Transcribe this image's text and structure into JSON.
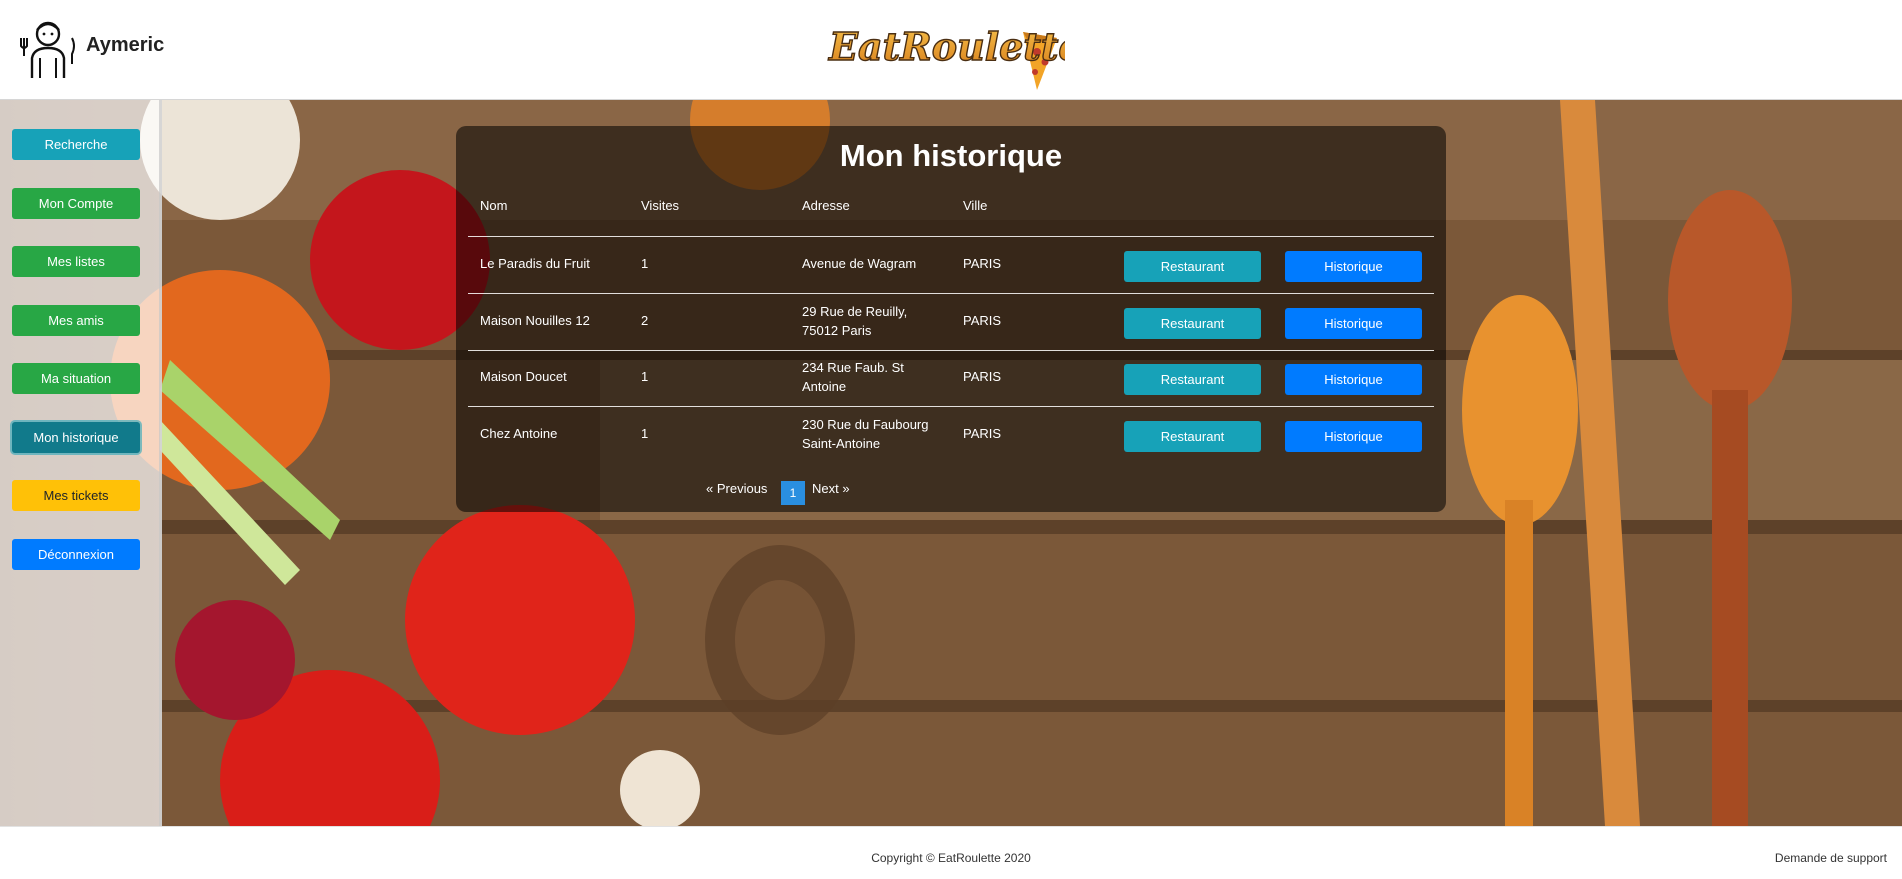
{
  "header": {
    "username": "Aymeric",
    "logo_text": "EatRoulette"
  },
  "sidebar": {
    "items": [
      {
        "label": "Recherche"
      },
      {
        "label": "Mon Compte"
      },
      {
        "label": "Mes listes"
      },
      {
        "label": "Mes amis"
      },
      {
        "label": "Ma situation"
      },
      {
        "label": "Mon historique"
      },
      {
        "label": "Mes tickets"
      },
      {
        "label": "Déconnexion"
      }
    ]
  },
  "history": {
    "title": "Mon historique",
    "columns": [
      "Nom",
      "Visites",
      "Adresse",
      "Ville"
    ],
    "rows": [
      {
        "name": "Le Paradis du Fruit",
        "visits": "1",
        "address_line1": "Avenue de Wagram",
        "address_line2": "",
        "city": "PARIS",
        "restaurant_label": "Restaurant",
        "history_label": "Historique"
      },
      {
        "name": "Maison Nouilles 12",
        "visits": "2",
        "address_line1": "29 Rue de Reuilly,",
        "address_line2": "75012 Paris",
        "city": "PARIS",
        "restaurant_label": "Restaurant",
        "history_label": "Historique"
      },
      {
        "name": "Maison Doucet",
        "visits": "1",
        "address_line1": "234 Rue Faub. St",
        "address_line2": "Antoine",
        "city": "PARIS",
        "restaurant_label": "Restaurant",
        "history_label": "Historique"
      },
      {
        "name": "Chez Antoine",
        "visits": "1",
        "address_line1": "230 Rue du Faubourg",
        "address_line2": "Saint-Antoine",
        "city": "PARIS",
        "restaurant_label": "Restaurant",
        "history_label": "Historique"
      }
    ],
    "pagination": {
      "prev_label": "« Previous",
      "current_page": "1",
      "next_label": "Next »"
    }
  },
  "footer": {
    "copyright": "Copyright © EatRoulette 2020",
    "support_link": "Demande de support"
  },
  "colors": {
    "info": "#17a2b8",
    "success": "#28a745",
    "warning": "#ffc107",
    "primary": "#007bff",
    "active": "#117a8b"
  }
}
